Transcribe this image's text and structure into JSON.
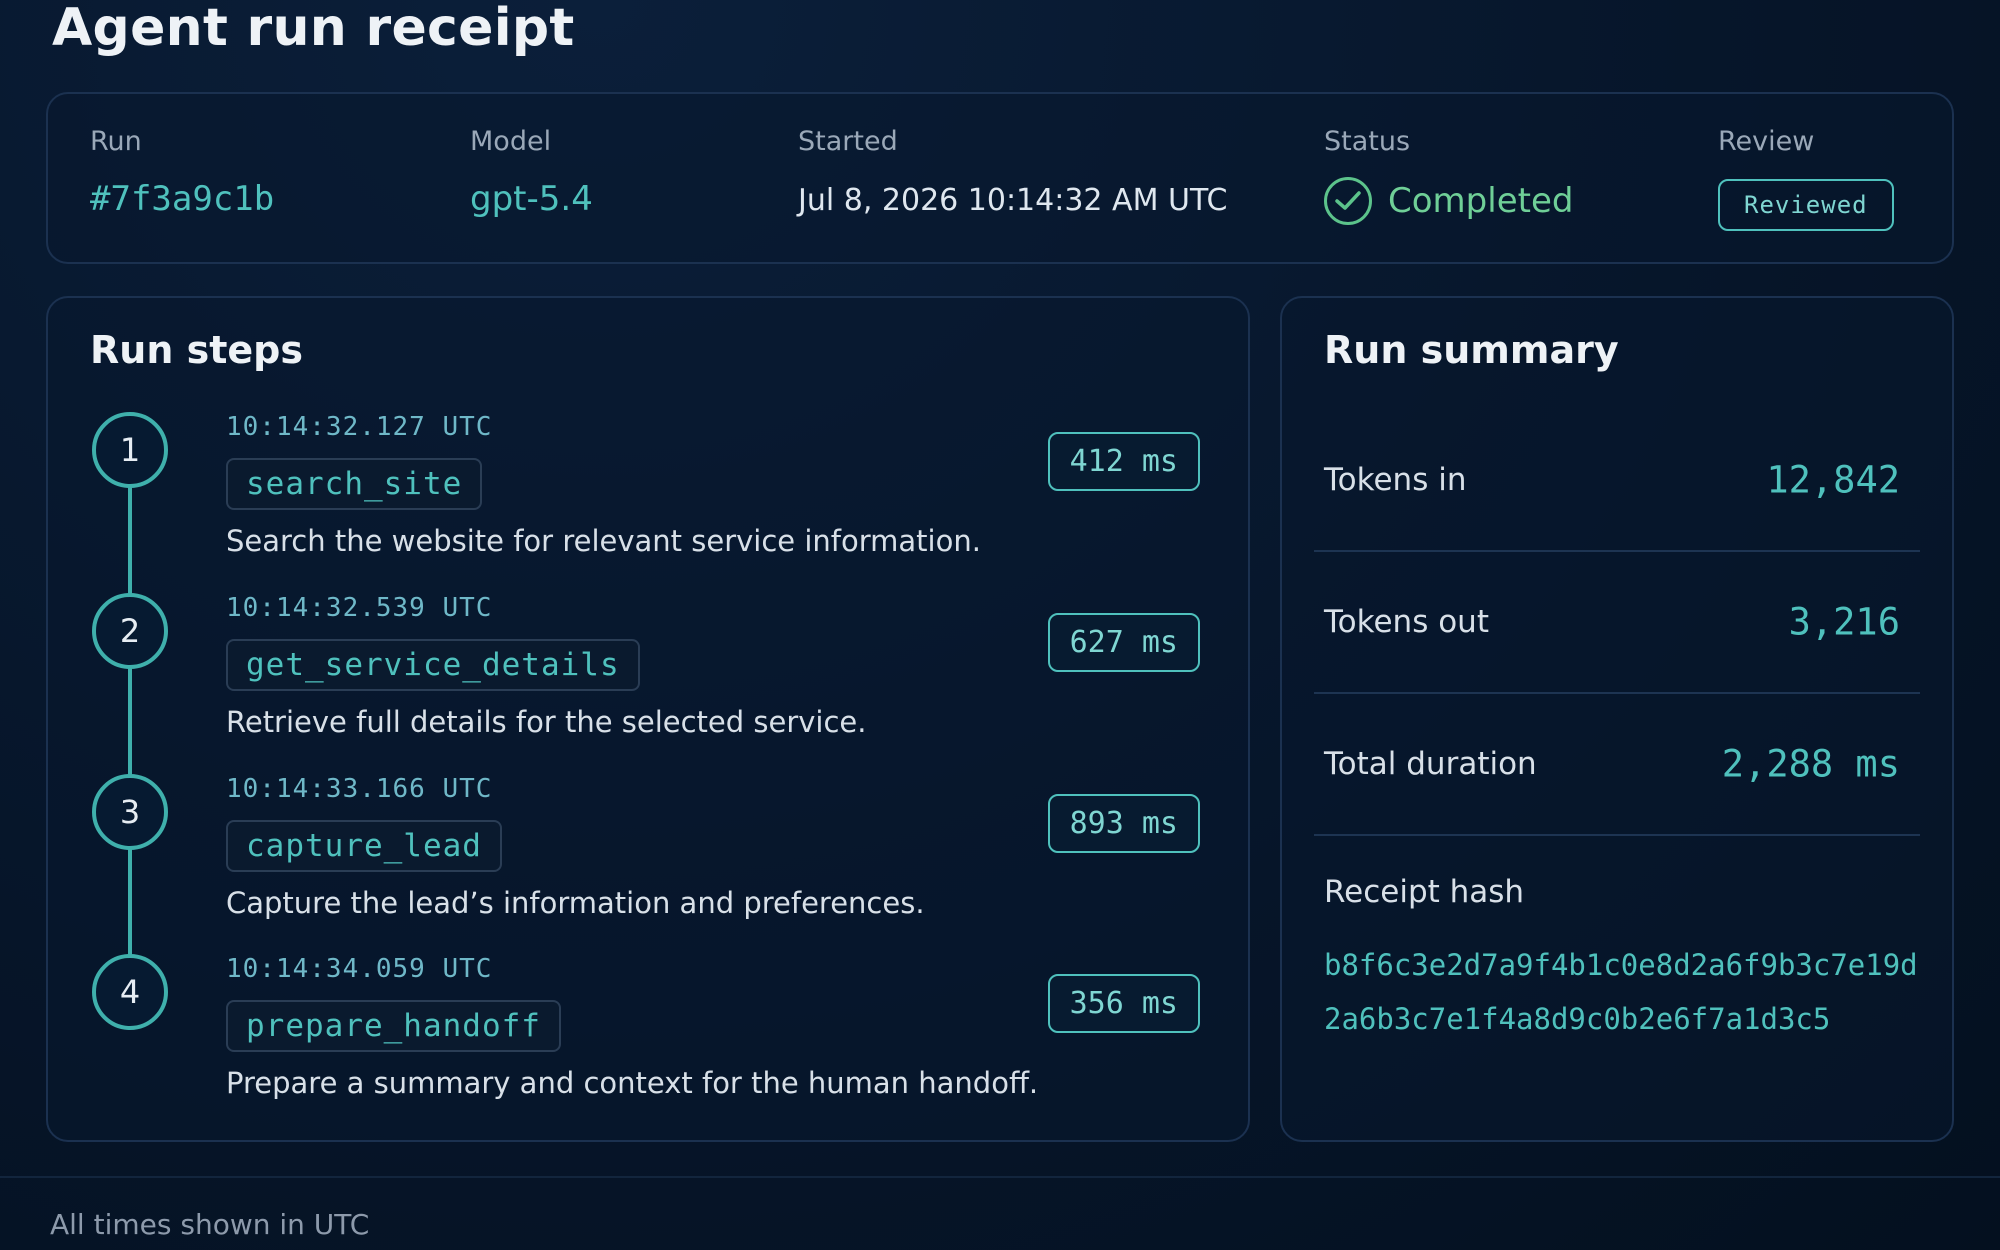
{
  "page": {
    "title": "Agent run receipt",
    "footer": "All times shown in UTC"
  },
  "meta": {
    "run_label": "Run",
    "run_value": "#7f3a9c1b",
    "model_label": "Model",
    "model_value": "gpt-5.4",
    "started_label": "Started",
    "started_value": "Jul 8, 2026 10:14:32 AM UTC",
    "status_label": "Status",
    "status_value": "Completed",
    "status_icon": "check-circle-icon",
    "review_label": "Review",
    "review_value": "Reviewed"
  },
  "steps": {
    "title": "Run steps",
    "items": [
      {
        "num": "1",
        "time": "10:14:32.127 UTC",
        "tool": "search_site",
        "desc": "Search the website for relevant service information.",
        "duration": "412 ms"
      },
      {
        "num": "2",
        "time": "10:14:32.539 UTC",
        "tool": "get_service_details",
        "desc": "Retrieve full details for the selected service.",
        "duration": "627 ms"
      },
      {
        "num": "3",
        "time": "10:14:33.166 UTC",
        "tool": "capture_lead",
        "desc": "Capture the lead’s information and preferences.",
        "duration": "893 ms"
      },
      {
        "num": "4",
        "time": "10:14:34.059 UTC",
        "tool": "prepare_handoff",
        "desc": "Prepare a summary and context for the human handoff.",
        "duration": "356 ms"
      }
    ]
  },
  "summary": {
    "title": "Run summary",
    "tokens_in_label": "Tokens in",
    "tokens_in_value": "12,842",
    "tokens_out_label": "Tokens out",
    "tokens_out_value": "3,216",
    "duration_label": "Total duration",
    "duration_value": "2,288 ms",
    "hash_label": "Receipt hash",
    "hash_value": "b8f6c3e2d7a9f4b1c0e8d2a6f9b3c7e19d2a6b3c7e1f4a8d9c0b2e6f7a1d3c5"
  },
  "colors": {
    "accent": "#4fc1bd",
    "success": "#6fcf97",
    "background": "#061529"
  }
}
